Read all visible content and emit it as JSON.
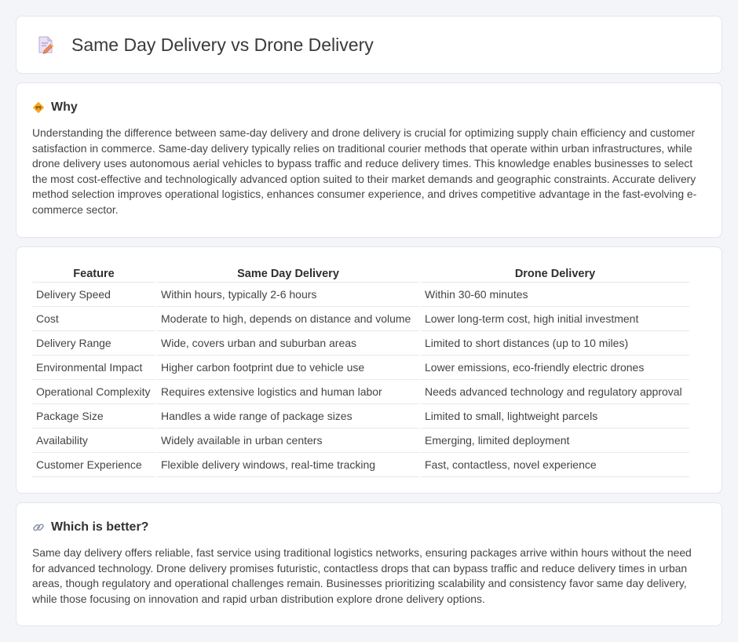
{
  "header": {
    "title": "Same Day Delivery vs Drone Delivery",
    "icon": "document-edit-icon"
  },
  "why": {
    "title": "Why",
    "icon": "warning-sign-icon",
    "text": "Understanding the difference between same-day delivery and drone delivery is crucial for optimizing supply chain efficiency and customer satisfaction in commerce. Same-day delivery typically relies on traditional courier methods that operate within urban infrastructures, while drone delivery uses autonomous aerial vehicles to bypass traffic and reduce delivery times. This knowledge enables businesses to select the most cost-effective and technologically advanced option suited to their market demands and geographic constraints. Accurate delivery method selection improves operational logistics, enhances consumer experience, and drives competitive advantage in the fast-evolving e-commerce sector."
  },
  "table": {
    "headers": [
      "Feature",
      "Same Day Delivery",
      "Drone Delivery"
    ],
    "rows": [
      [
        "Delivery Speed",
        "Within hours, typically 2-6 hours",
        "Within 30-60 minutes"
      ],
      [
        "Cost",
        "Moderate to high, depends on distance and volume",
        "Lower long-term cost, high initial investment"
      ],
      [
        "Delivery Range",
        "Wide, covers urban and suburban areas",
        "Limited to short distances (up to 10 miles)"
      ],
      [
        "Environmental Impact",
        "Higher carbon footprint due to vehicle use",
        "Lower emissions, eco-friendly electric drones"
      ],
      [
        "Operational Complexity",
        "Requires extensive logistics and human labor",
        "Needs advanced technology and regulatory approval"
      ],
      [
        "Package Size",
        "Handles a wide range of package sizes",
        "Limited to small, lightweight parcels"
      ],
      [
        "Availability",
        "Widely available in urban centers",
        "Emerging, limited deployment"
      ],
      [
        "Customer Experience",
        "Flexible delivery windows, real-time tracking",
        "Fast, contactless, novel experience"
      ]
    ]
  },
  "better": {
    "title": "Which is better?",
    "icon": "link-icon",
    "text": "Same day delivery offers reliable, fast service using traditional logistics networks, ensuring packages arrive within hours without the need for advanced technology. Drone delivery promises futuristic, contactless drops that can bypass traffic and reduce delivery times in urban areas, though regulatory and operational challenges remain. Businesses prioritizing scalability and consistency favor same day delivery, while those focusing on innovation and rapid urban distribution explore drone delivery options."
  }
}
